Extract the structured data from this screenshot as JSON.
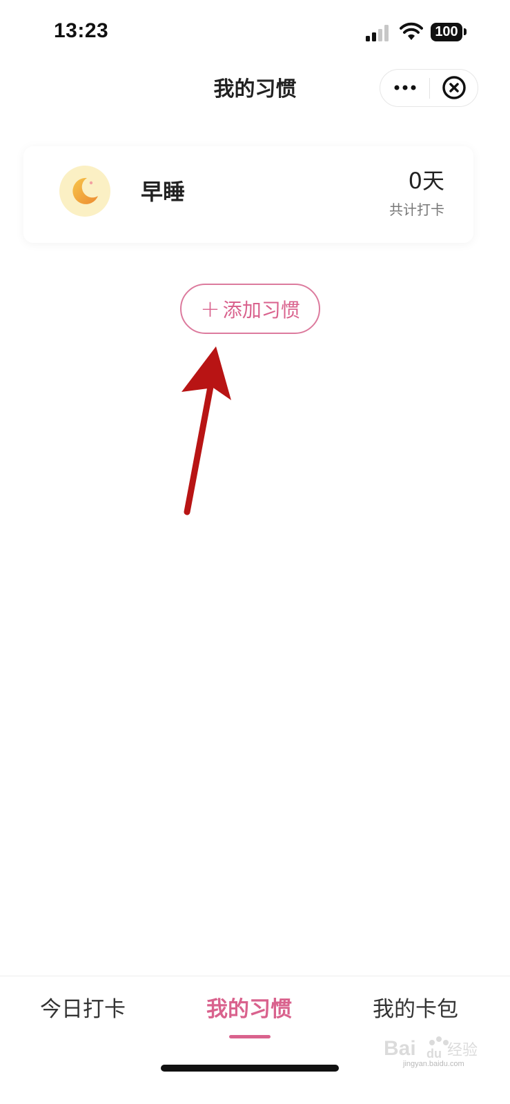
{
  "status_bar": {
    "time": "13:23",
    "battery": "100",
    "icons": [
      "signal-icon",
      "wifi-icon",
      "battery-icon"
    ]
  },
  "nav": {
    "title": "我的习惯",
    "capsule_icons": [
      "more-icon",
      "close-icon"
    ]
  },
  "habits": [
    {
      "name": "早睡",
      "icon": "moon-icon",
      "days": "0天",
      "days_label": "共计打卡"
    }
  ],
  "add_button": {
    "plus": "+",
    "label": "添加习惯"
  },
  "annotation": {
    "icon": "arrow-up-icon",
    "color": "#b81414"
  },
  "tabs": [
    {
      "label": "今日打卡",
      "active": false
    },
    {
      "label": "我的习惯",
      "active": true
    },
    {
      "label": "我的卡包",
      "active": false
    }
  ],
  "colors": {
    "accent": "#d9628d",
    "avatar_bg": "#fbf0c4",
    "moon": "#f0a73a"
  },
  "watermark": {
    "brand": "Baidu 经验",
    "url": "jingyan.baidu.com"
  }
}
